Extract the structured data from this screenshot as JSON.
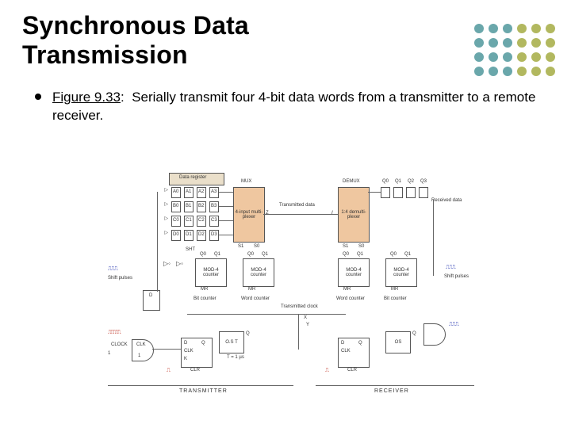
{
  "title_line1": "Synchronous Data",
  "title_line2": "Transmission",
  "figure_ref": "Figure 9.33",
  "figure_sep": ":",
  "figure_desc": "Serially transmit four 4-bit data words from a transmitter to a remote receiver.",
  "diagram": {
    "data_register": "Data register",
    "mux": "MUX",
    "mux_inner": "4-input multi-plexer",
    "demux": "DEMUX",
    "demux_inner": "1:4 demulti-plexer",
    "transmitted_data": "Transmitted data",
    "received_data": "Received data",
    "mod4": "MOD-4 counter",
    "mr": "MR",
    "clk": "CLK",
    "bit_counter": "Bit counter",
    "word_counter": "Word counter",
    "transmitted_clock": "Transmitted clock",
    "shift_pulses": "Shift pulses",
    "ost": "O.S T",
    "q": "Q",
    "clock": "CLOCK",
    "clr": "CLR",
    "os": "OS",
    "transmitter": "TRANSMITTER",
    "receiver": "RECEIVER",
    "x": "X",
    "z": "Z",
    "y": "Y",
    "t_label": "T = 1 µs",
    "one": "1",
    "s0": "S0",
    "s1": "S1",
    "q0": "Q0",
    "q1": "Q1",
    "q2": "Q2",
    "q3": "Q3",
    "rows": {
      "A": [
        "A0",
        "A1",
        "A2",
        "A3"
      ],
      "B": [
        "B0",
        "B1",
        "B2",
        "B3"
      ],
      "C": [
        "C0",
        "C1",
        "C2",
        "C3"
      ],
      "D": [
        "D0",
        "D1",
        "D2",
        "D3"
      ]
    }
  },
  "colors": {
    "teal": "#6aa7ab",
    "olive": "#b2b85f",
    "peach": "#efc7a0",
    "rust": "#b46a40",
    "blue": "#2838b0",
    "red": "#c23a2c"
  }
}
